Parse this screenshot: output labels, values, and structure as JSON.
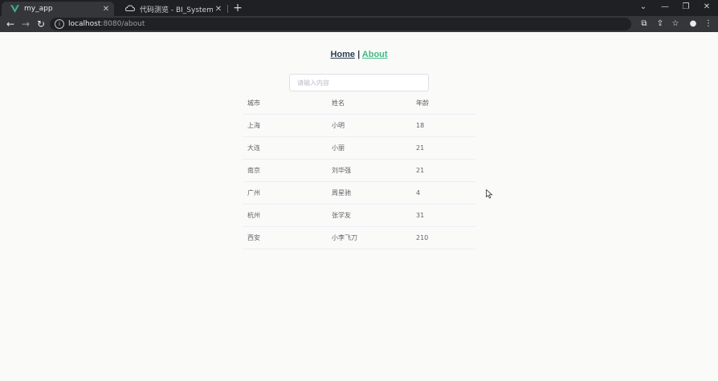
{
  "browser": {
    "tabs": [
      {
        "title": "my_app",
        "active": true,
        "icon": "vue-logo-icon"
      },
      {
        "title": "代码测览 - BI_System - M Stan",
        "active": false,
        "icon": "cloud-icon"
      }
    ],
    "address": {
      "host": "localhost",
      "path": ":8080/about"
    }
  },
  "nav": {
    "home": "Home",
    "separator": "|",
    "about": "About"
  },
  "search": {
    "placeholder": "请输入内容",
    "value": ""
  },
  "table": {
    "headers": [
      "城市",
      "姓名",
      "年龄"
    ],
    "rows": [
      [
        "上海",
        "小明",
        "18"
      ],
      [
        "大连",
        "小丽",
        "21"
      ],
      [
        "南京",
        "刘华强",
        "21"
      ],
      [
        "广州",
        "周星驰",
        "4"
      ],
      [
        "杭州",
        "张学友",
        "31"
      ],
      [
        "西安",
        "小李飞刀",
        "210"
      ]
    ]
  },
  "colors": {
    "accent": "#42b983",
    "text": "#2c3e50",
    "chrome_dark": "#1f2023",
    "chrome_toolbar": "#35363a"
  }
}
